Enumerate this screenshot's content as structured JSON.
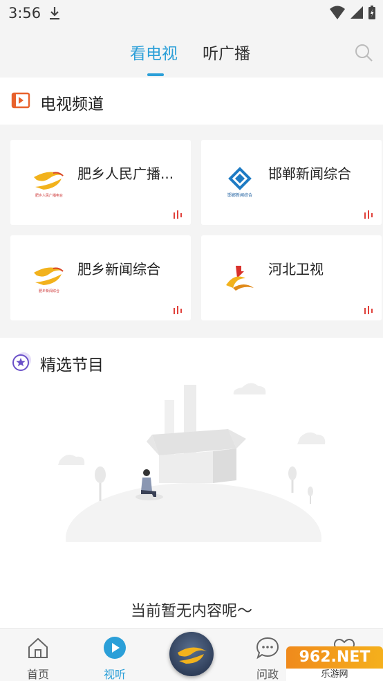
{
  "status_bar": {
    "time": "3:56"
  },
  "top_tabs": {
    "tv": "看电视",
    "radio": "听广播"
  },
  "tv_section": {
    "title": "电视频道"
  },
  "channels": [
    {
      "name": "肥乡人民广播...",
      "logo": "feixiang-logo",
      "logo_caption": "肥乡人民广播电台"
    },
    {
      "name": "邯郸新闻综合",
      "logo": "handan-logo",
      "logo_caption": "邯郸新闻综合"
    },
    {
      "name": "肥乡新闻综合",
      "logo": "feixiang-logo",
      "logo_caption": "肥乡新闻综合"
    },
    {
      "name": "河北卫视",
      "logo": "hebei-logo"
    }
  ],
  "featured": {
    "title": "精选节目",
    "empty_text": "当前暂无内容呢～"
  },
  "bottom_nav": {
    "home": "首页",
    "watch": "视听",
    "ask": "问政",
    "more": ""
  },
  "watermark": {
    "main": "962.NET",
    "sub": "乐游网"
  },
  "colors": {
    "accent": "#2b9fd8",
    "live_bars": "#e0403a",
    "tv_icon": "#e8612c",
    "feat_icon": "#6a4fc8"
  }
}
